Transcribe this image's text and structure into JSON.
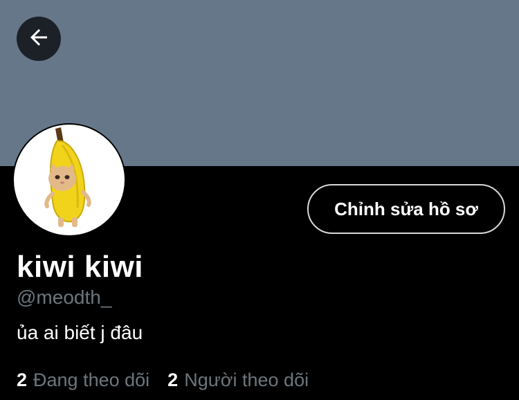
{
  "header": {
    "back_icon": "arrow-left-icon"
  },
  "profile": {
    "avatar_icon": "banana-cat-avatar",
    "edit_button_label": "Chỉnh sửa hồ sơ",
    "display_name": "kiwi kiwi",
    "handle": "@meodth_",
    "bio": "ủa ai biết j đâu"
  },
  "stats": {
    "following_count": "2",
    "following_label": "Đang theo dõi",
    "followers_count": "2",
    "followers_label": "Người theo dõi"
  },
  "colors": {
    "banner": "#66778a",
    "background": "#000000",
    "secondary_text": "#6e767d"
  }
}
